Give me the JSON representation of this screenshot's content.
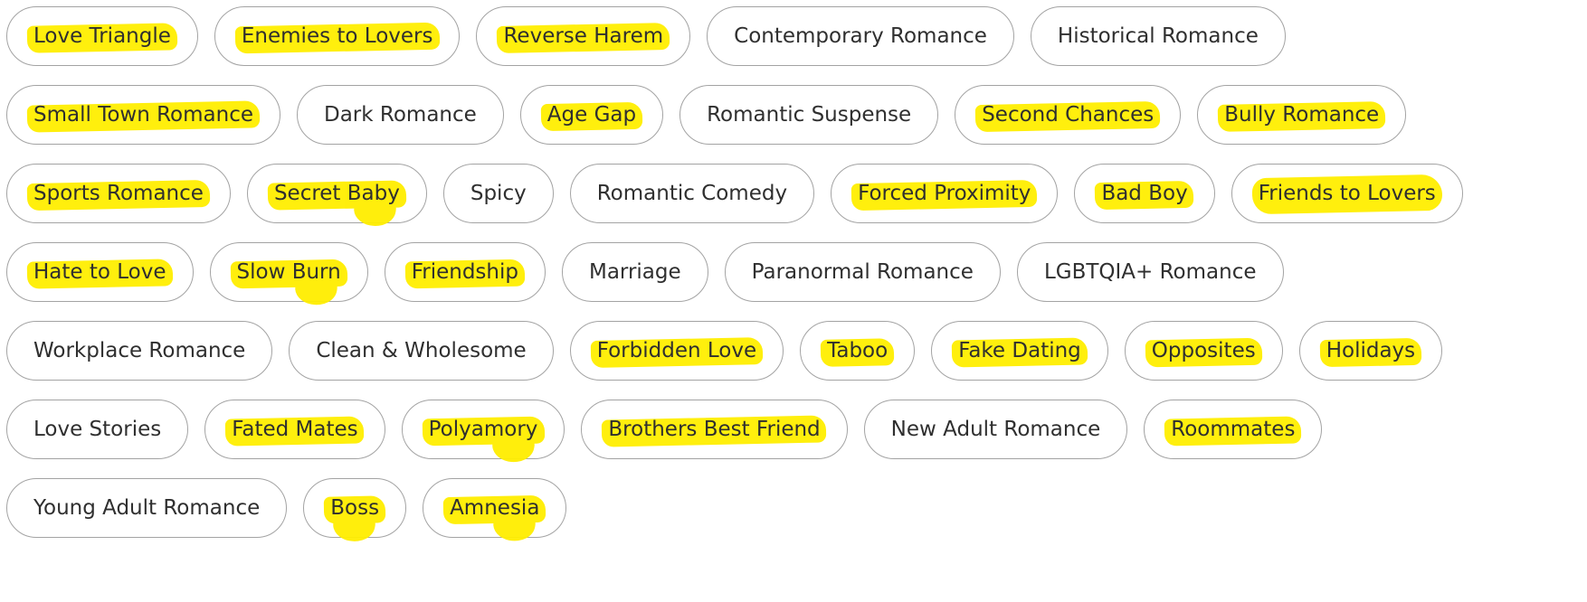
{
  "colors": {
    "highlight": "#ffee00",
    "chip_border": "#a3a3a3",
    "chip_text": "#2f2f2f",
    "background": "#ffffff"
  },
  "rows": [
    [
      {
        "label": "Love Triangle",
        "highlighted": true
      },
      {
        "label": "Enemies to Lovers",
        "highlighted": true
      },
      {
        "label": "Reverse Harem",
        "highlighted": true
      },
      {
        "label": "Contemporary Romance",
        "highlighted": false
      },
      {
        "label": "Historical Romance",
        "highlighted": false
      }
    ],
    [
      {
        "label": "Small Town Romance",
        "highlighted": true
      },
      {
        "label": "Dark Romance",
        "highlighted": false
      },
      {
        "label": "Age Gap",
        "highlighted": true
      },
      {
        "label": "Romantic Suspense",
        "highlighted": false
      },
      {
        "label": "Second Chances",
        "highlighted": true
      },
      {
        "label": "Bully Romance",
        "highlighted": true
      }
    ],
    [
      {
        "label": "Sports Romance",
        "highlighted": true
      },
      {
        "label": "Secret Baby",
        "highlighted": true
      },
      {
        "label": "Spicy",
        "highlighted": false
      },
      {
        "label": "Romantic Comedy",
        "highlighted": false
      },
      {
        "label": "Forced Proximity",
        "highlighted": true
      },
      {
        "label": "Bad Boy",
        "highlighted": true
      },
      {
        "label": "Friends to Lovers",
        "highlighted": true
      }
    ],
    [
      {
        "label": "Hate to Love",
        "highlighted": true
      },
      {
        "label": "Slow Burn",
        "highlighted": true
      },
      {
        "label": "Friendship",
        "highlighted": true
      },
      {
        "label": "Marriage",
        "highlighted": false
      },
      {
        "label": "Paranormal Romance",
        "highlighted": false
      },
      {
        "label": "LGBTQIA+ Romance",
        "highlighted": false
      }
    ],
    [
      {
        "label": "Workplace Romance",
        "highlighted": false
      },
      {
        "label": "Clean & Wholesome",
        "highlighted": false
      },
      {
        "label": "Forbidden Love",
        "highlighted": true
      },
      {
        "label": "Taboo",
        "highlighted": true
      },
      {
        "label": "Fake Dating",
        "highlighted": true
      },
      {
        "label": "Opposites",
        "highlighted": true
      },
      {
        "label": "Holidays",
        "highlighted": true
      }
    ],
    [
      {
        "label": "Love Stories",
        "highlighted": false
      },
      {
        "label": "Fated Mates",
        "highlighted": true
      },
      {
        "label": "Polyamory",
        "highlighted": true
      },
      {
        "label": "Brothers Best Friend",
        "highlighted": true
      },
      {
        "label": "New Adult Romance",
        "highlighted": false
      },
      {
        "label": "Roommates",
        "highlighted": true
      }
    ],
    [
      {
        "label": "Young Adult Romance",
        "highlighted": false
      },
      {
        "label": "Boss",
        "highlighted": true
      },
      {
        "label": "Amnesia",
        "highlighted": true
      }
    ]
  ]
}
